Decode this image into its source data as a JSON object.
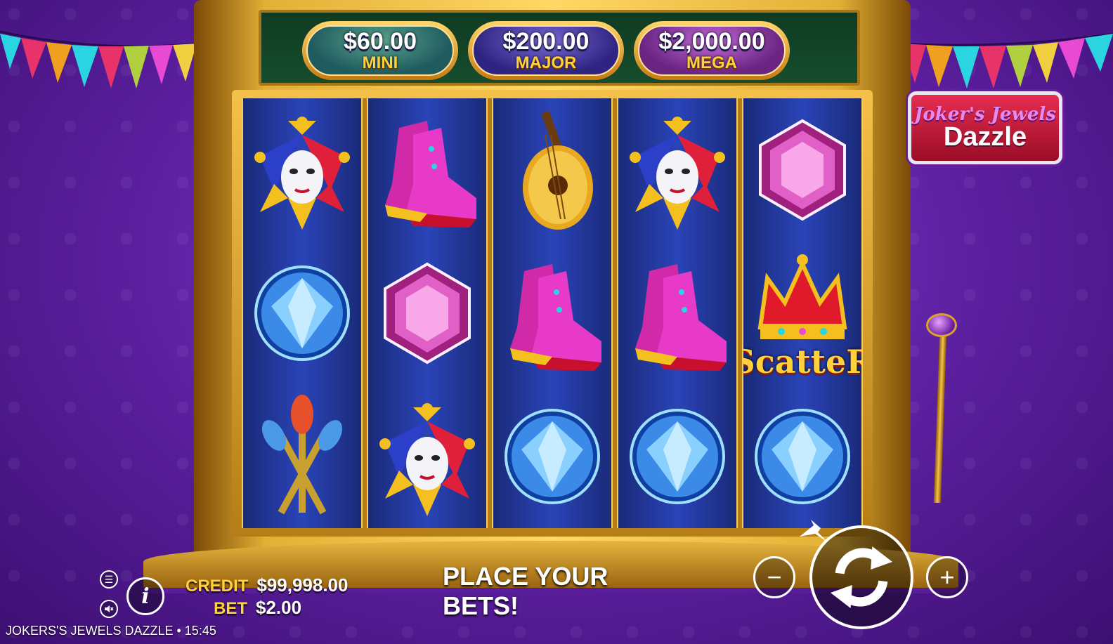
{
  "game": {
    "footer_title": "JOKERS'S JEWELS DAZZLE • 15:45"
  },
  "logo": {
    "top": "Joker's Jewels",
    "bottom": "Dazzle"
  },
  "jackpots": [
    {
      "amount": "$60.00",
      "label": "MINI"
    },
    {
      "amount": "$200.00",
      "label": "MAJOR"
    },
    {
      "amount": "$2,000.00",
      "label": "MEGA"
    }
  ],
  "reels": [
    [
      "jester-mask",
      "blue-diamond",
      "scepters"
    ],
    [
      "jester-boots",
      "pink-gem",
      "jester-mask"
    ],
    [
      "lute",
      "jester-boots",
      "blue-diamond"
    ],
    [
      "jester-mask",
      "jester-boots",
      "blue-diamond"
    ],
    [
      "pink-gem",
      "crown-scatter",
      "blue-diamond"
    ]
  ],
  "scatter_text": "ScatteR",
  "status": {
    "message": "PLACE YOUR BETS!",
    "credit_label": "CREDIT",
    "credit_value": "$99,998.00",
    "bet_label": "BET",
    "bet_value": "$2.00"
  },
  "controls": {
    "menu_icon": "☰",
    "sound_icon": "🔇",
    "info_icon": "i",
    "minus": "−",
    "plus": "+"
  },
  "colors": {
    "gold": "#ffd23c",
    "purple_bg": "#5b1f9e",
    "reel_blue": "#2a44b8"
  }
}
